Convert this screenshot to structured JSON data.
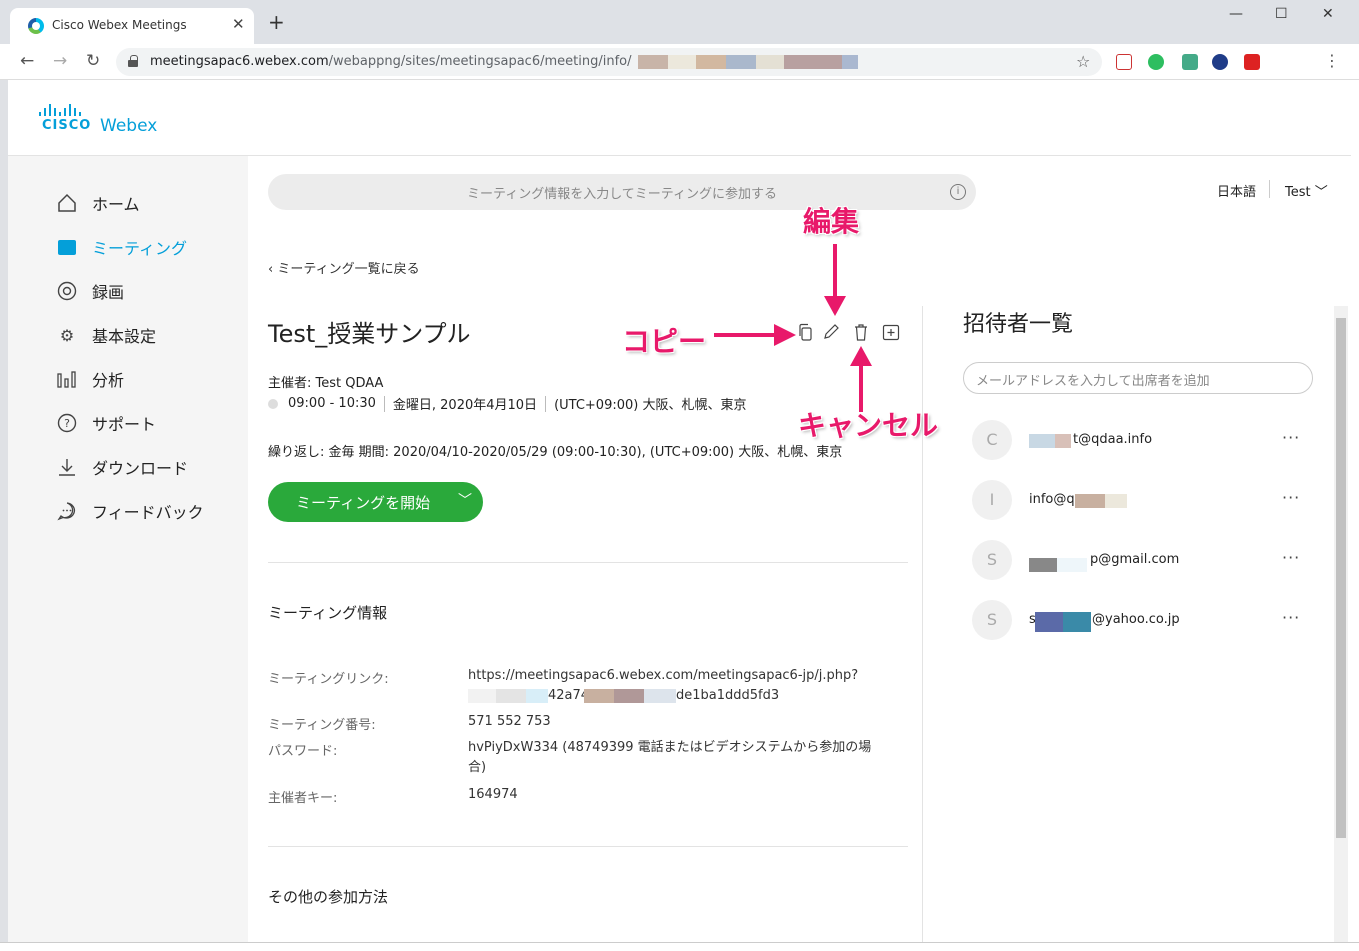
{
  "browser": {
    "tab_title": "Cisco Webex Meetings",
    "url_host": "meetingsapac6.webex.com",
    "url_path": "/webappng/sites/meetingsapac6/meeting/info/"
  },
  "brand": {
    "cisco": "CISCO",
    "webex": "Webex",
    "accent": "#049fd9"
  },
  "sidebar": {
    "items": [
      {
        "label": "ホーム",
        "icon": "home-icon"
      },
      {
        "label": "ミーティング",
        "icon": "calendar-icon",
        "active": true
      },
      {
        "label": "録画",
        "icon": "record-icon"
      },
      {
        "label": "基本設定",
        "icon": "gear-icon"
      },
      {
        "label": "分析",
        "icon": "analytics-icon"
      },
      {
        "label": "サポート",
        "icon": "help-icon"
      },
      {
        "label": "ダウンロード",
        "icon": "download-icon"
      },
      {
        "label": "フィードバック",
        "icon": "feedback-icon"
      }
    ]
  },
  "header": {
    "join_placeholder": "ミーティング情報を入力してミーティングに参加する",
    "language": "日本語",
    "user": "Test"
  },
  "meeting": {
    "back_label": "ミーティング一覧に戻る",
    "title": "Test_授業サンプル",
    "host": "主催者: Test QDAA",
    "time": "09:00 - 10:30",
    "date": "金曜日, 2020年4月10日",
    "timezone": "(UTC+09:00) 大阪、札幌、東京",
    "recurrence": "繰り返し: 金毎 期間: 2020/04/10-2020/05/29 (09:00-10:30), (UTC+09:00) 大阪、札幌、東京",
    "start_button": "ミーティングを開始",
    "info_heading": "ミーティング情報",
    "link_label": "ミーティングリンク:",
    "link_value_line1": "https://meetingsapac6.webex.com/meetingsapac6-jp/j.php?",
    "link_value_part_a": "42a74",
    "link_value_part_b": "de1ba1ddd5fd3",
    "number_label": "ミーティング番号:",
    "number_value": "571 552 753",
    "password_label": "パスワード:",
    "password_value_line1": "hvPiyDxW334 (48749399 電話またはビデオシステムから参加の場",
    "password_value_line2": "合)",
    "hostkey_label": "主催者キー:",
    "hostkey_value": "164974",
    "other_heading": "その他の参加方法"
  },
  "invitees": {
    "title": "招待者一覧",
    "input_placeholder": "メールアドレスを入力して出席者を追加",
    "list": [
      {
        "initial": "C",
        "email_visible": "t@qdaa.info"
      },
      {
        "initial": "I",
        "email_visible": "info@q"
      },
      {
        "initial": "S",
        "email_visible": "p@gmail.com"
      },
      {
        "initial": "S",
        "email_prefix": "s",
        "email_visible": "@yahoo.co.jp"
      }
    ],
    "more_label": "···"
  },
  "annotations": {
    "edit": "編集",
    "copy": "コピー",
    "cancel": "キャンセル",
    "color": "#e8196a"
  },
  "colors": {
    "start_button": "#2aa93b"
  }
}
